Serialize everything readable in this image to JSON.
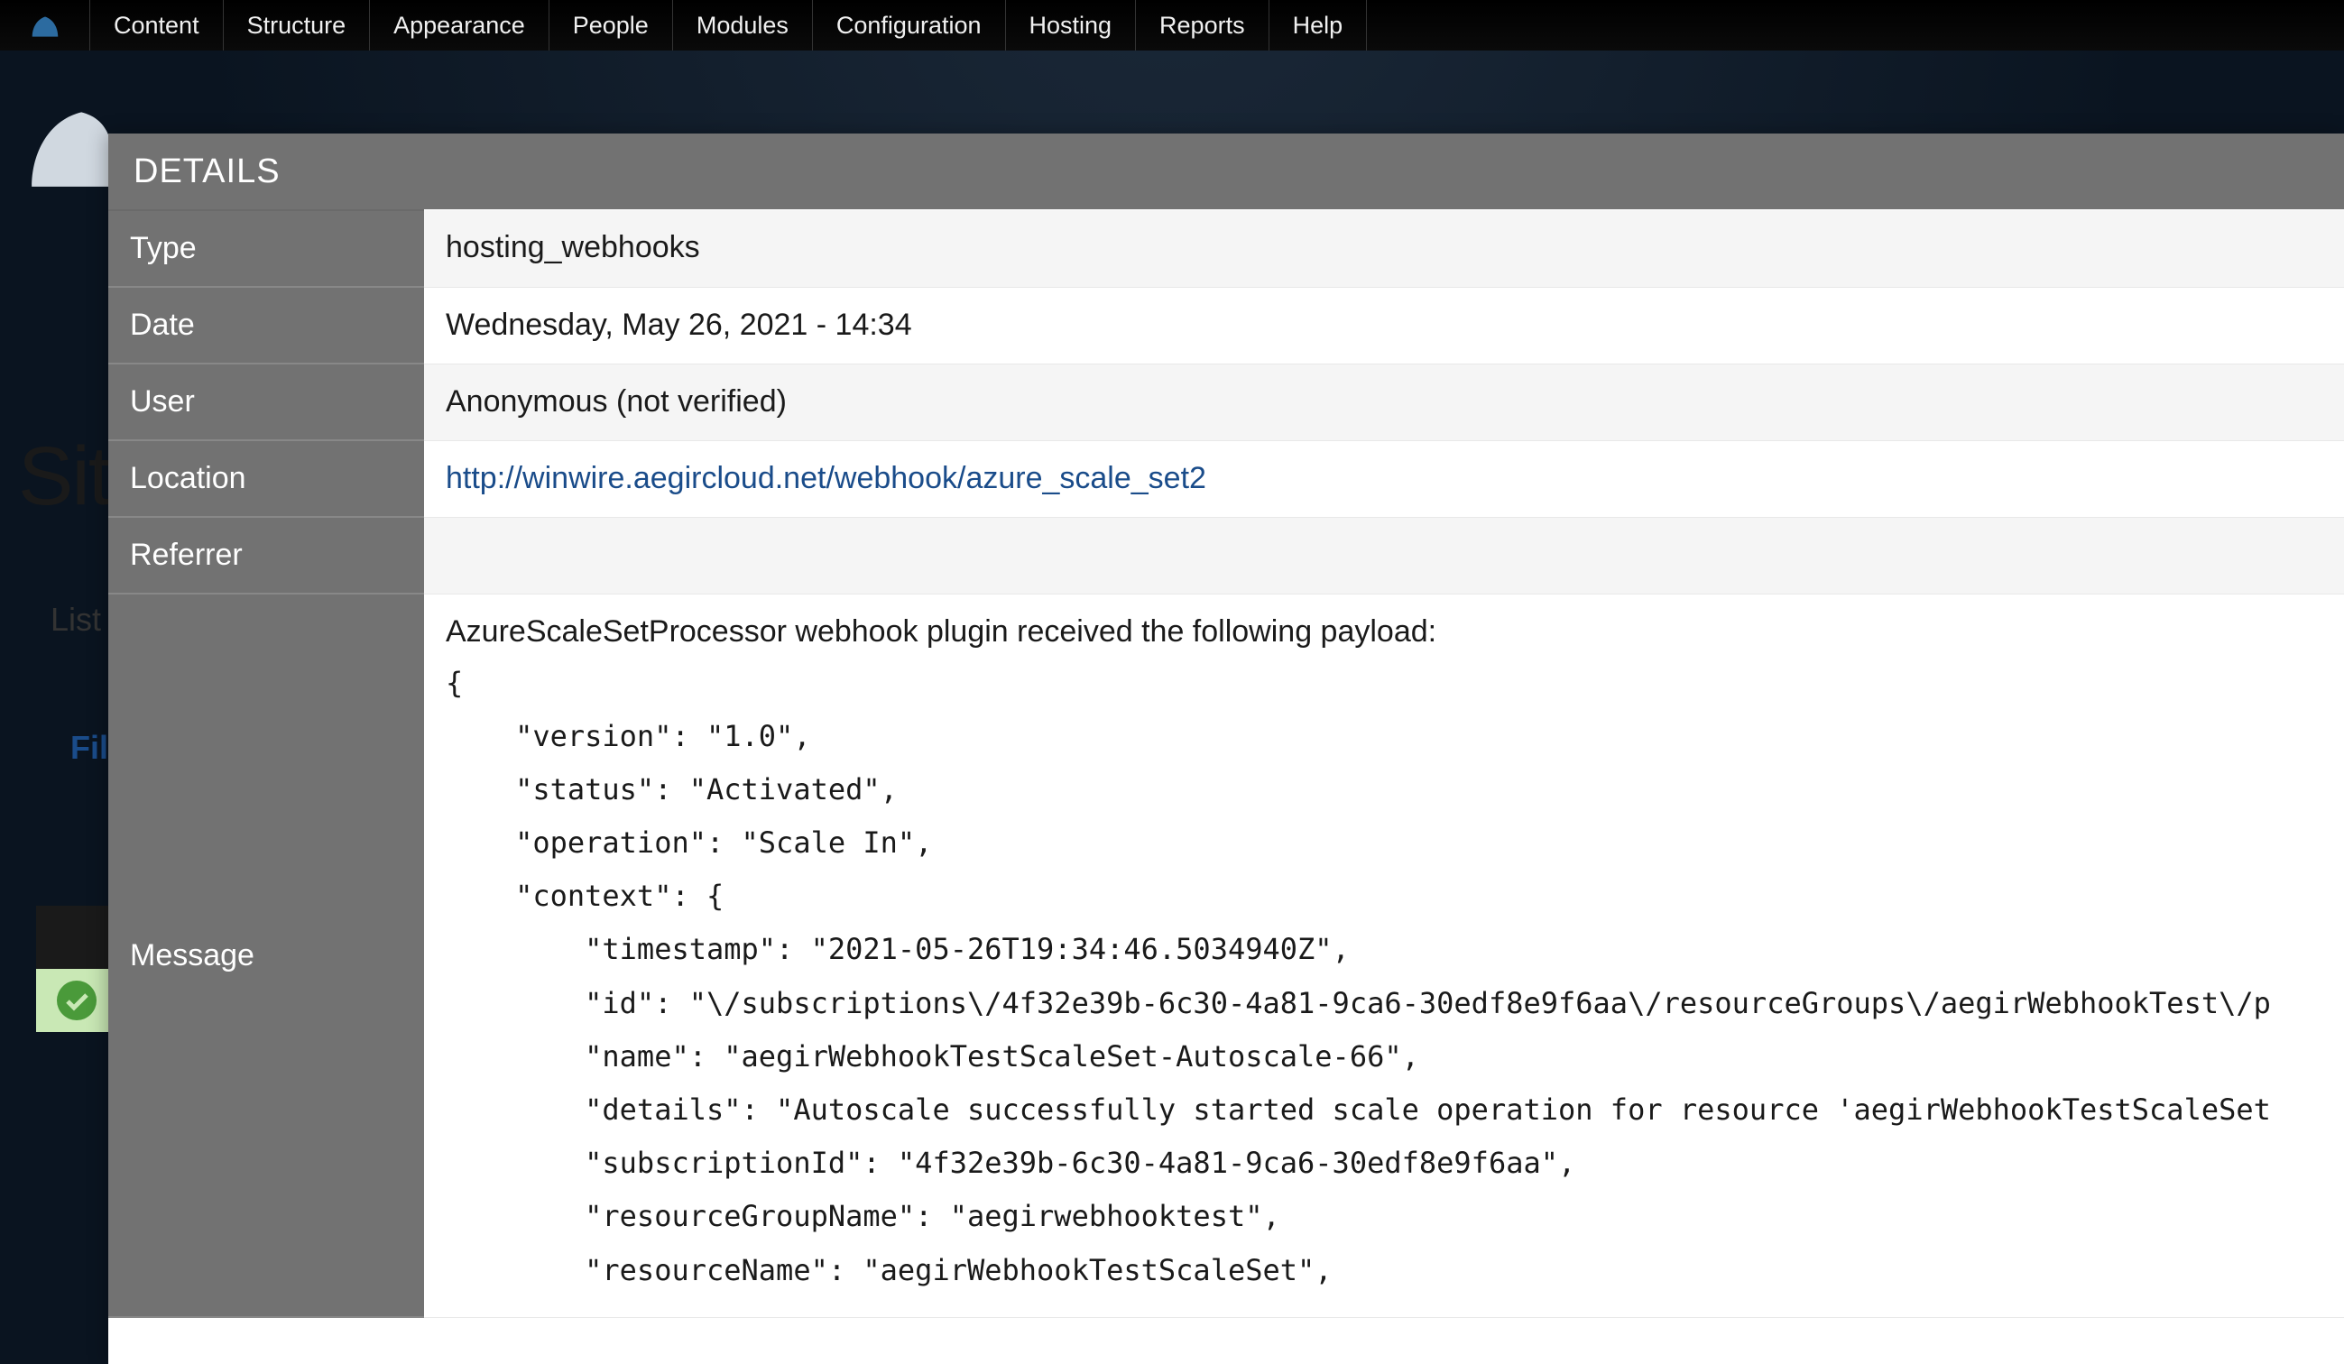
{
  "toolbar": {
    "items": [
      "Content",
      "Structure",
      "Appearance",
      "People",
      "Modules",
      "Configuration",
      "Hosting",
      "Reports",
      "Help"
    ]
  },
  "background": {
    "page_title": "Sit",
    "list_tab": "List",
    "filter_label": "Fil"
  },
  "overlay": {
    "heading": "DETAILS",
    "rows": {
      "type": {
        "label": "Type",
        "value": "hosting_webhooks"
      },
      "date": {
        "label": "Date",
        "value": "Wednesday, May 26, 2021 - 14:34"
      },
      "user": {
        "label": "User",
        "value": "Anonymous (not verified)"
      },
      "location": {
        "label": "Location",
        "value": "http://winwire.aegircloud.net/webhook/azure_scale_set2"
      },
      "referrer": {
        "label": "Referrer",
        "value": ""
      },
      "message": {
        "label": "Message",
        "intro": "AzureScaleSetProcessor webhook plugin received the following payload:",
        "payload": "{\n    \"version\": \"1.0\",\n    \"status\": \"Activated\",\n    \"operation\": \"Scale In\",\n    \"context\": {\n        \"timestamp\": \"2021-05-26T19:34:46.5034940Z\",\n        \"id\": \"\\/subscriptions\\/4f32e39b-6c30-4a81-9ca6-30edf8e9f6aa\\/resourceGroups\\/aegirWebhookTest\\/p\n        \"name\": \"aegirWebhookTestScaleSet-Autoscale-66\",\n        \"details\": \"Autoscale successfully started scale operation for resource 'aegirWebhookTestScaleSet\n        \"subscriptionId\": \"4f32e39b-6c30-4a81-9ca6-30edf8e9f6aa\",\n        \"resourceGroupName\": \"aegirwebhooktest\",\n        \"resourceName\": \"aegirWebhookTestScaleSet\","
      }
    }
  }
}
